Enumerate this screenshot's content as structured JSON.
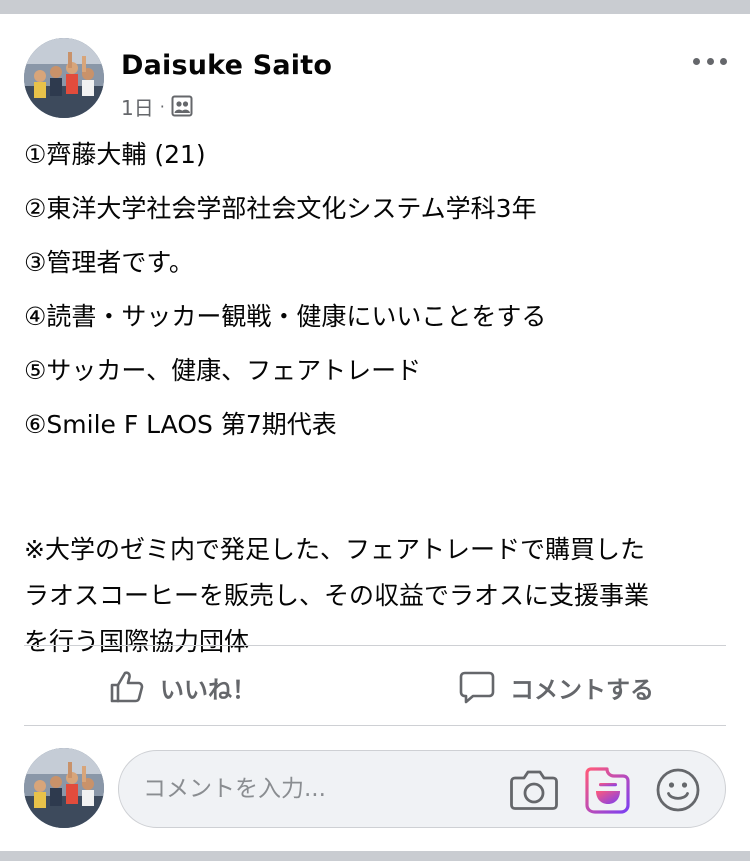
{
  "post": {
    "author": "Daisuke Saito",
    "time": "1日",
    "separator": "·",
    "audience_icon": "group-audience-icon",
    "more_icon": "more-options-icon",
    "lines": [
      "①齊藤大輔 (21)",
      "②東洋大学社会学部社会文化システム学科3年",
      "③管理者です。",
      "④読書・サッカー観戦・健康にいいことをする",
      "⑤サッカー、健康、フェアトレード",
      "⑥Smile F LAOS 第7期代表"
    ],
    "note_lines": [
      "※大学のゼミ内で発足した、フェアトレードで購買した",
      "ラオスコーヒーを販売し、その収益でラオスに支援事業",
      "を行う国際協力団体"
    ]
  },
  "actions": {
    "like_label": "いいね！",
    "comment_label": "コメントする"
  },
  "comment_box": {
    "placeholder": "コメントを入力..."
  },
  "colors": {
    "text_primary": "#050505",
    "text_secondary": "#65676b",
    "divider": "#ced0d4",
    "input_background": "#f0f2f5",
    "gif_gradient_start": "#ff5a7a",
    "gif_gradient_end": "#7b3ff2"
  }
}
